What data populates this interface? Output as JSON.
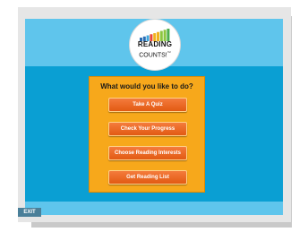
{
  "logo": {
    "title": "READING",
    "subtitle": "COUNTS!",
    "trademark": "™",
    "bar_colors": [
      "#2a6db5",
      "#2a6db5",
      "#3fa9df",
      "#e8463b",
      "#f0b21c",
      "#f0b21c",
      "#8cc63f",
      "#8cc63f",
      "#4cae4c"
    ]
  },
  "panel": {
    "title": "What would you like to do?"
  },
  "menu": {
    "take_quiz": "Take A Quiz",
    "check_progress": "Check Your Progress",
    "choose_interests": "Choose Reading Interests",
    "get_list": "Get Reading List"
  },
  "footer": {
    "exit_label": "EXIT"
  },
  "colors": {
    "header_bg": "#5fc5ec",
    "main_bg": "#0a9fd3",
    "panel_bg": "#f7a81b",
    "button_bg": "#e25a12",
    "exit_bg": "#4a7f99"
  }
}
